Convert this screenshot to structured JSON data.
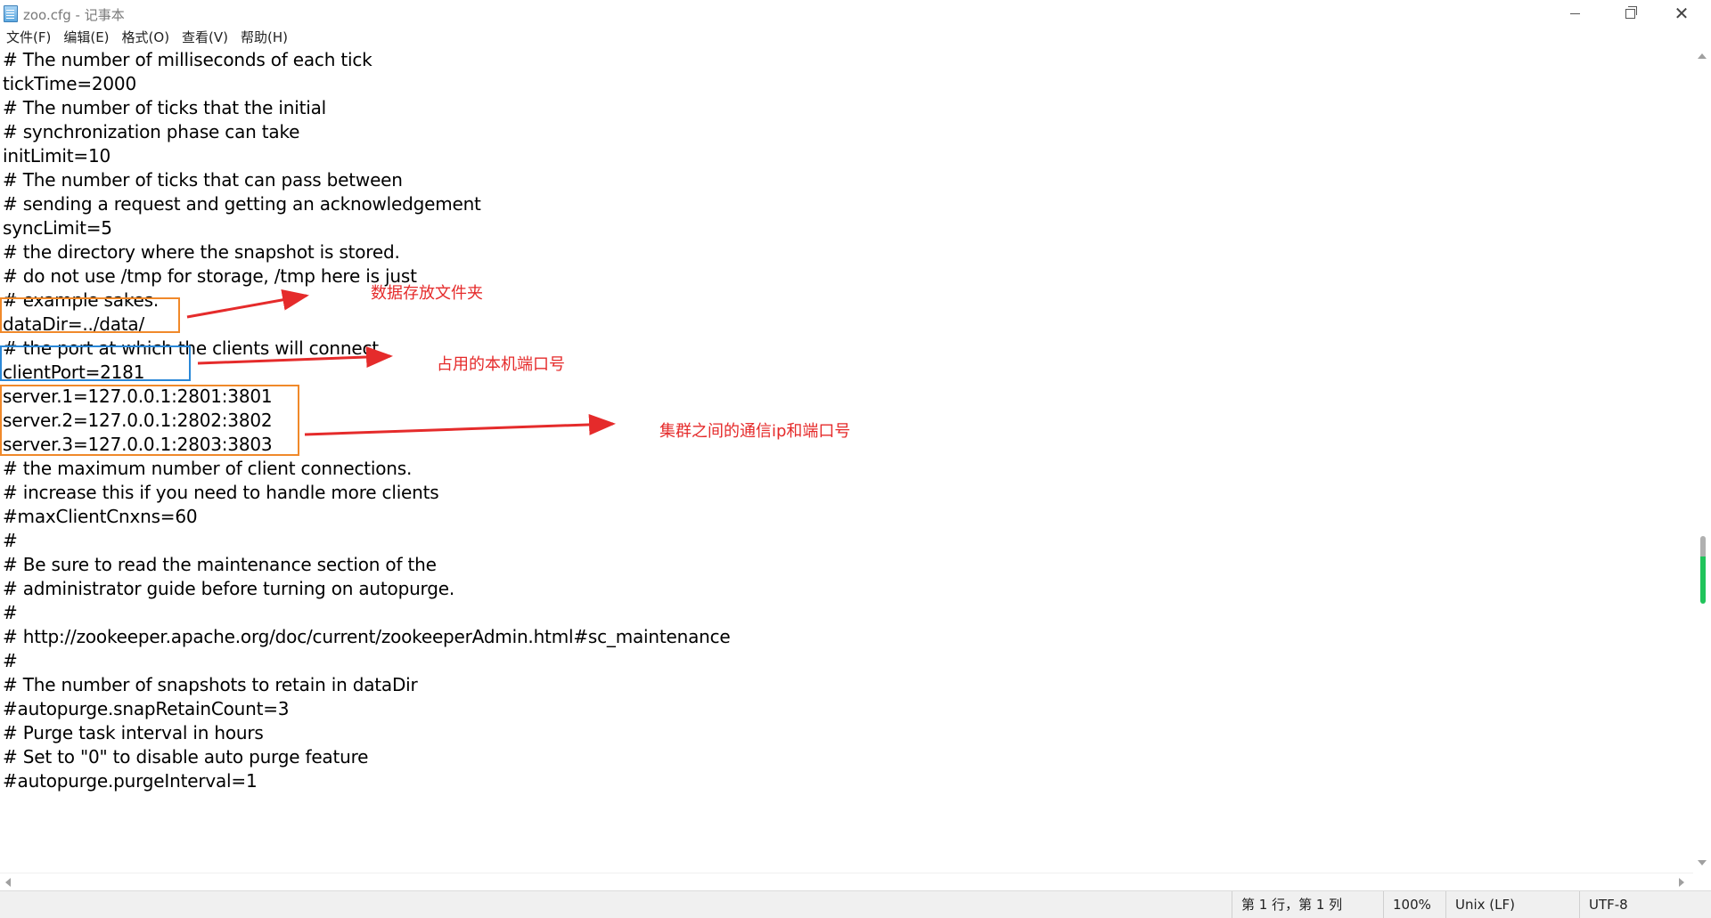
{
  "window": {
    "title": "zoo.cfg - 记事本",
    "minimize": "minimize",
    "maximize": "restore",
    "close": "✕"
  },
  "menu": [
    "文件(F)",
    "编辑(E)",
    "格式(O)",
    "查看(V)",
    "帮助(H)"
  ],
  "lines": [
    "# The number of milliseconds of each tick",
    "tickTime=2000",
    "# The number of ticks that the initial",
    "# synchronization phase can take",
    "initLimit=10",
    "# The number of ticks that can pass between",
    "# sending a request and getting an acknowledgement",
    "syncLimit=5",
    "# the directory where the snapshot is stored.",
    "# do not use /tmp for storage, /tmp here is just",
    "# example sakes.",
    "dataDir=../data/",
    "# the port at which the clients will connect",
    "clientPort=2181",
    "server.1=127.0.0.1:2801:3801",
    "server.2=127.0.0.1:2802:3802",
    "server.3=127.0.0.1:2803:3803",
    "# the maximum number of client connections.",
    "# increase this if you need to handle more clients",
    "#maxClientCnxns=60",
    "#",
    "# Be sure to read the maintenance section of the",
    "# administrator guide before turning on autopurge.",
    "#",
    "# http://zookeeper.apache.org/doc/current/zookeeperAdmin.html#sc_maintenance",
    "#",
    "# The number of snapshots to retain in dataDir",
    "#autopurge.snapRetainCount=3",
    "# Purge task interval in hours",
    "# Set to \"0\" to disable auto purge feature",
    "#autopurge.purgeInterval=1"
  ],
  "annotations": {
    "data_dir_note": "数据存放文件夹",
    "client_port_note": "占用的本机端口号",
    "servers_note": "集群之间的通信ip和端口号",
    "box_color_orange": "#f0892a",
    "box_color_blue": "#2a88d8",
    "arrow_color": "#e52b2b"
  },
  "status": {
    "position": "第 1 行，第 1 列",
    "zoom": "100%",
    "line_ending": "Unix (LF)",
    "encoding": "UTF-8"
  },
  "scrollbar": {
    "thumb_color": "#21c45b"
  }
}
